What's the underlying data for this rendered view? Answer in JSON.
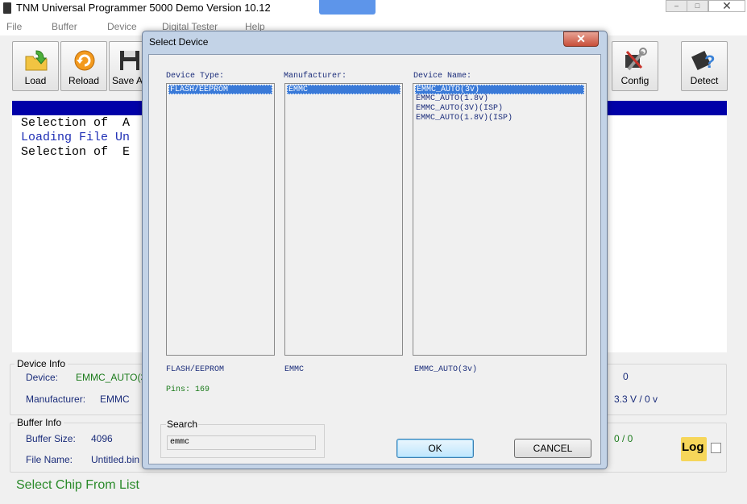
{
  "window": {
    "title": "TNM  Universal Programmer 5000 Demo   Version 10.12",
    "minimize": "–",
    "restore": "□",
    "close": "✕"
  },
  "menu": [
    "File",
    "Buffer",
    "Device",
    "Digital Tester",
    "Help"
  ],
  "toolbar": {
    "load": "Load",
    "reload": "Reload",
    "save": "Save A",
    "config": "Config",
    "detect": "Detect"
  },
  "log": {
    "lines": [
      "Selection of  A",
      "Loading File Un",
      "Selection of  E"
    ]
  },
  "device_info": {
    "title": "Device Info",
    "device_label": "Device:",
    "device_value": "EMMC_AUTO(3",
    "manufacturer_label": "Manufacturer:",
    "manufacturer_value": "EMMC",
    "right_value_1": "0",
    "right_value_2": "3.3 V / 0 v"
  },
  "buffer_info": {
    "title": "Buffer Info",
    "size_label": "Buffer Size:",
    "size_value": "4096",
    "file_label": "File Name:",
    "file_value": "Untitled.bin",
    "right_value": "0 / 0"
  },
  "log_toggle": {
    "label": "Log"
  },
  "status": "Select Chip From List",
  "dialog": {
    "title": "Select Device",
    "close": "✕",
    "device_type_header": "Device Type:",
    "manufacturer_header": "Manufacturer:",
    "device_name_header": "Device Name:",
    "device_types": [
      "FLASH/EEPROM"
    ],
    "manufacturers": [
      "EMMC"
    ],
    "device_names": [
      "EMMC_AUTO(3v)",
      "EMMC_AUTO(1.8v)",
      "EMMC_AUTO(3V)(ISP)",
      "EMMC_AUTO(1.8V)(ISP)"
    ],
    "selected_type": "FLASH/EEPROM",
    "selected_manufacturer": "EMMC",
    "selected_name": "EMMC_AUTO(3v)",
    "pins": "Pins: 169",
    "search_label": "Search",
    "search_value": "emmc",
    "ok": "OK",
    "cancel": "CANCEL"
  }
}
